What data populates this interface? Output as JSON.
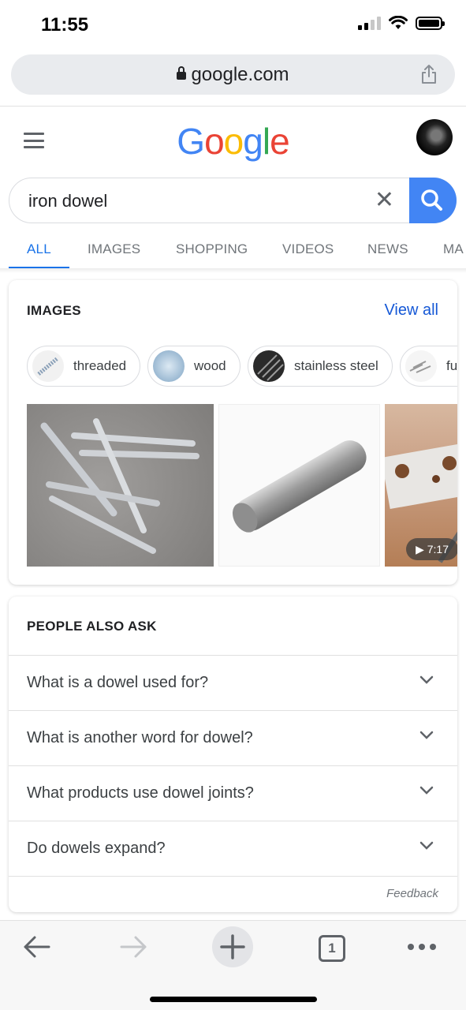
{
  "status_bar": {
    "time": "11:55"
  },
  "browser": {
    "url": "google.com"
  },
  "google": {
    "logo_letters": [
      {
        "ch": "G",
        "color": "#4285f4"
      },
      {
        "ch": "o",
        "color": "#ea4335"
      },
      {
        "ch": "o",
        "color": "#fbbc05"
      },
      {
        "ch": "g",
        "color": "#4285f4"
      },
      {
        "ch": "l",
        "color": "#34a853"
      },
      {
        "ch": "e",
        "color": "#ea4335"
      }
    ]
  },
  "search": {
    "query": "iron dowel",
    "clear_icon": "close-icon",
    "submit_icon": "search-icon"
  },
  "tabs": [
    {
      "label": "ALL",
      "active": true
    },
    {
      "label": "IMAGES",
      "active": false
    },
    {
      "label": "SHOPPING",
      "active": false
    },
    {
      "label": "VIDEOS",
      "active": false
    },
    {
      "label": "NEWS",
      "active": false
    },
    {
      "label": "MA",
      "active": false
    }
  ],
  "images_card": {
    "title": "IMAGES",
    "view_all": "View all",
    "chips": [
      {
        "label": "threaded"
      },
      {
        "label": "wood"
      },
      {
        "label": "stainless steel"
      },
      {
        "label": "fu"
      }
    ],
    "video_duration": "7:17"
  },
  "paa_card": {
    "title": "PEOPLE ALSO ASK",
    "questions": [
      "What is a dowel used for?",
      "What is another word for dowel?",
      "What products use dowel joints?",
      "Do dowels expand?"
    ],
    "feedback": "Feedback"
  },
  "toolbar": {
    "tab_count": "1"
  },
  "colors": {
    "accent": "#1a73e8",
    "search_button": "#4285f4"
  }
}
